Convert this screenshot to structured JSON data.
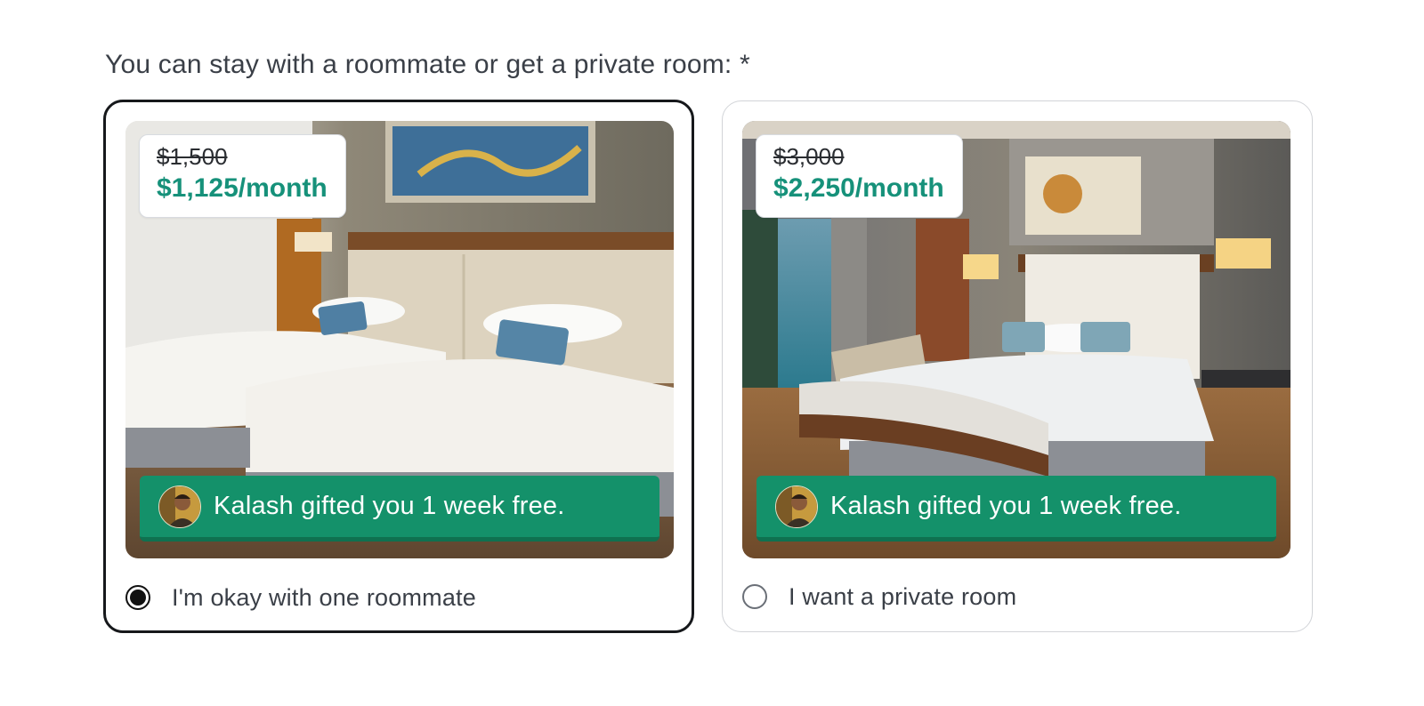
{
  "question": "You can stay with a roommate or get a private room: *",
  "options": [
    {
      "old_price": "$1,500",
      "new_price": "$1,125/month",
      "gift_text": "Kalash gifted you 1 week free.",
      "label": "I'm okay with one roommate",
      "selected": true,
      "image": "twin-beds-room-photo"
    },
    {
      "old_price": "$3,000",
      "new_price": "$2,250/month",
      "gift_text": "Kalash gifted you 1 week free.",
      "label": "I want a private room",
      "selected": false,
      "image": "king-bed-room-photo"
    }
  ],
  "colors": {
    "accent_green": "#14916a",
    "price_green": "#16917a",
    "selected_border": "#16181b",
    "card_border": "#d2d4d8"
  }
}
